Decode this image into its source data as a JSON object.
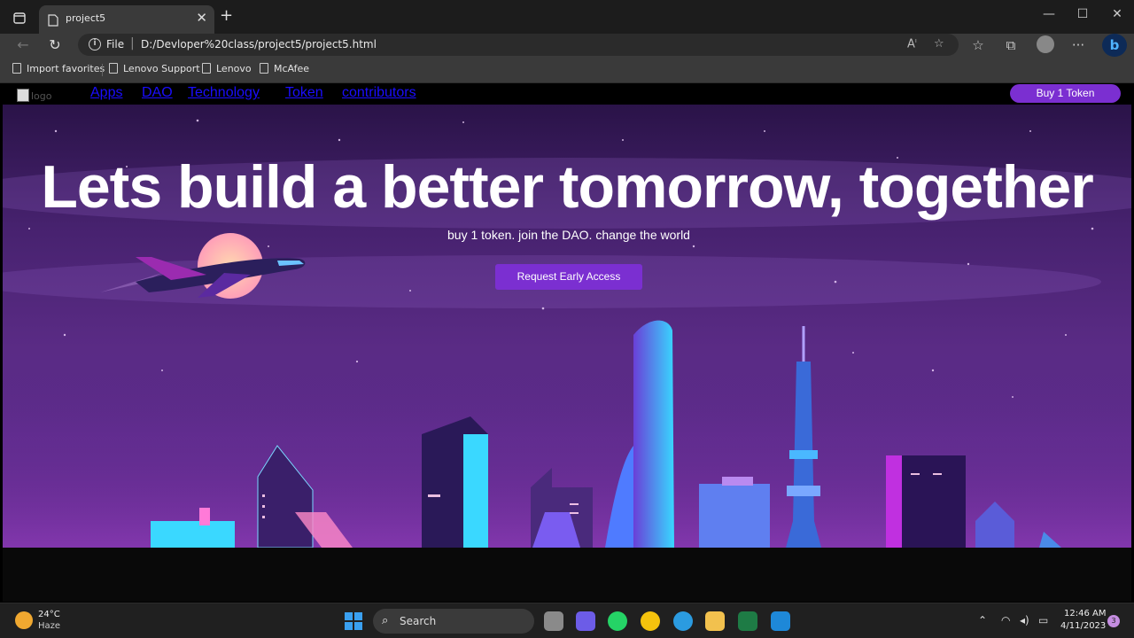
{
  "browser": {
    "tab_title": "project5",
    "address_scheme": "File",
    "address_url": "D:/Devloper%20class/project5/project5.html"
  },
  "favorites": [
    {
      "label": "Import favorites"
    },
    {
      "label": "Lenovo Support"
    },
    {
      "label": "Lenovo"
    },
    {
      "label": "McAfee"
    }
  ],
  "site": {
    "logo_alt": "logo",
    "nav": [
      {
        "label": "Apps"
      },
      {
        "label": "DAO"
      },
      {
        "label": "Technology"
      },
      {
        "label": "Token"
      },
      {
        "label": "contributors"
      }
    ],
    "buy_label": "Buy 1 Token"
  },
  "hero": {
    "headline": "Lets build a better tomorrow, together",
    "subline": "buy 1 token. join the DAO. change the world",
    "cta_label": "Request Early Access"
  },
  "taskbar": {
    "temperature": "24°C",
    "weather": "Haze",
    "search_label": "Search",
    "time": "12:46 AM",
    "date": "4/11/2023",
    "notification_count": "3"
  },
  "colors": {
    "accent_purple": "#7b2fd1",
    "link_blue": "#1a0dff"
  }
}
